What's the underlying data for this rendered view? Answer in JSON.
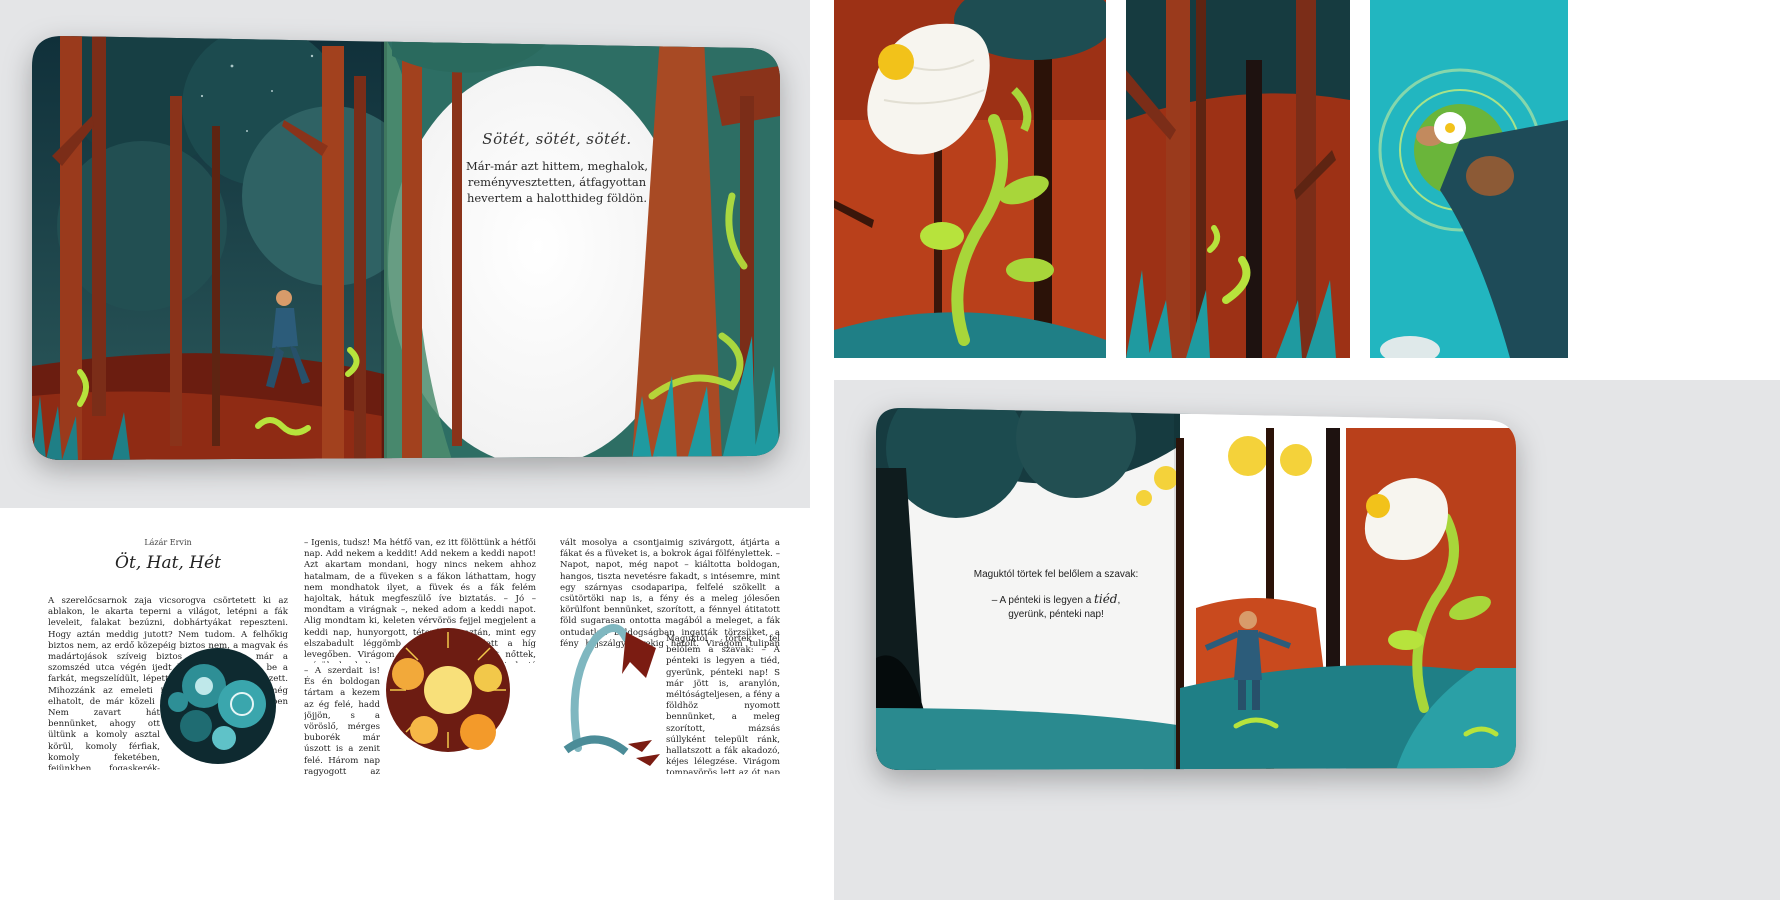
{
  "spread1": {
    "heading": "Sötét, sötét, sötét.",
    "text": "Már-már azt hittem, meghalok, reményvesztetten, átfagyottan hevertem a halotthideg földön."
  },
  "layout_page": {
    "author": "Lázár Ervin",
    "title": "Öt, Hat, Hét",
    "col1_top": "A szerelőcsarnok zaja vicsorogva csörtetett ki az ablakon, le akarta teperni a világot, letépni a fák leveleit, falakat bezúzni, dobhártyákat repeszteni. Hogy aztán meddig jutott? Nem tudom. A felhőkig biztos nem, az erdő közepéig biztos nem, a magvak és madártojások szíveig biztos nem. Talán már a szomszéd utca végén ijedt kuvasszként húzta be a farkát, megszelídült, lépett még kettőt, s elenyészett. Mihozzánk az emeleti irodába mindenesetre még elhatolt, de már közeli halálának tudatában, éppen hogy csak surrogott-zurrogott.",
    "col1_bottom": "Nem zavart hát bennünket, ahogy ott ültünk a komoly asztal körül, komoly férfiak, komoly feketében, fejünkben fogaskerék-áttételek, transzmissziók, súrlódási együttha-",
    "col2_top": "– Igenis, tudsz! Ma hétfő van, ez itt fölöttünk a hétfői nap. Add nekem a keddit! Add nekem a keddi napot! Azt akartam mondani, hogy nincs nekem ahhoz hatalmam, de a füveken s a fákon láthattam, hogy nem mondhatok ilyet, a füvek és a fák felém hajoltak, hátuk megfeszülő íve biztatás. – Jó – mondtam a virágnak –, neked adom a keddi napot. Alig mondtam ki, keleten vérvörös fejjel megjelent a keddi nap, hunyorgott, tétovázott, aztán, mint egy elszabadult léggömb emelkedni kezdett a híg levegőben. Virágom szirmai szemlátomást nőttek, színük kankalinos sárgára változott. – Látod, jó langyos, látod – motyogta, egy szemvillanásra elmosolyodott, s a két nap pompár még mindig vacogva azt mondta:",
    "col2_bottom": "– A szerdait is! És én boldogan tártam a kezem az ég felé, hadd jöjjön, s a vöröslő, mérges buborék már úszott is a zenit felé. Három nap ragyogott az égen, háromszoros",
    "col3_top": "vált mosolya a csontjaimig szivárgott, átjárta a fákat és a füveket is, a bokrok ágai fölfénylettek. – Napot, napot, még napot – kiáltotta boldogan, hangos, tiszta nevetésre fakadt, s intésemre, mint egy szárnyas csodaparipa, felfelé szökellt a csütörtöki nap is, a fény és a meleg jólesően körülfont bennünket, szorított, a fénnyel átitatott föld sugarasan ontotta magából a meleget, a fák ontudatlan boldogságban ingatták törzsüket, a fény hajszálgyökerekig hatolt. Virágom tulipán nagyságúra nőtt, drágakövek kék villódzásával pompázott, fénylett, akár odafönn a négy nap.",
    "col3_bottom": "Maguktól törtek fel belőlem a szavak: – A pénteki is legyen a tiéd, gyerünk, pénteki nap! S már jött is, aranylón, méltóságteljesen, a fény a földhöz nyomott bennünket, a meleg szorított, mázsás súllyként települt ránk, hallatszott a fák akadozó, kéjes lélegzése. Virágom tompavörös lett az ót nap ragyogásában, buja és kaćér, vérejtékcsikorta arcom előtt"
  },
  "spread2": {
    "line1": "Maguktól törtek fel belőlem a szavak:",
    "line2a": "– A pénteki is legyen a ",
    "line2b": "tiéd",
    "line2c": ",",
    "line3": "gyerünk, pénteki nap!"
  },
  "colors": {
    "forest_dark": "#1d4a4e",
    "trunk": "#8a3a1e",
    "red_forest": "#b2411c",
    "teal": "#23b9c4",
    "sprout": "#a8d63a",
    "sun": "#f4d23a"
  }
}
